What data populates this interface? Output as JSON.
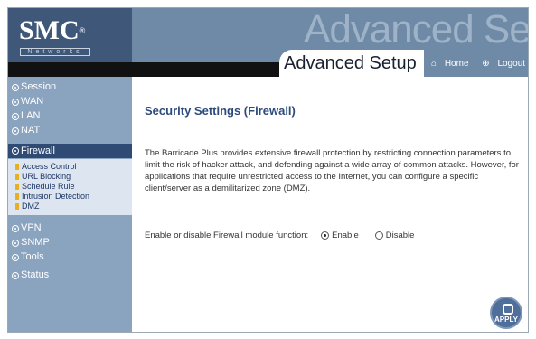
{
  "header": {
    "logo_text": "SMC",
    "logo_mark": "®",
    "logo_sub": "Networks",
    "watermark": "Advanced Setup",
    "title": "Advanced Setup",
    "nav_home": "Home",
    "nav_logout": "Logout",
    "icons": {
      "home": "home-icon",
      "logout": "logout-icon"
    }
  },
  "sidebar": {
    "items": [
      {
        "label": "Session"
      },
      {
        "label": "WAN"
      },
      {
        "label": "LAN"
      },
      {
        "label": "NAT"
      },
      {
        "label": "Firewall",
        "active": true
      },
      {
        "label": "VPN"
      },
      {
        "label": "SNMP"
      },
      {
        "label": "Tools"
      },
      {
        "label": "Status"
      }
    ],
    "submenu": [
      {
        "label": "Access Control"
      },
      {
        "label": "URL Blocking"
      },
      {
        "label": "Schedule Rule"
      },
      {
        "label": "Intrusion Detection"
      },
      {
        "label": "DMZ"
      }
    ]
  },
  "content": {
    "title": "Security Settings (Firewall)",
    "description": "The Barricade Plus provides extensive firewall protection by restricting connection parameters to limit the risk of hacker attack, and defending against a wide array of common attacks. However, for applications that require unrestricted access to the Internet, you can configure a specific client/server as a demilitarized zone (DMZ).",
    "form": {
      "label": "Enable or disable Firewall module function:",
      "options": [
        {
          "label": "Enable",
          "checked": true
        },
        {
          "label": "Disable",
          "checked": false
        }
      ]
    },
    "apply_label": "APPLY"
  },
  "colors": {
    "header_bg": "#6f8aa6",
    "logo_bg": "#3f587a",
    "sidebar_bg": "#8aa3bf",
    "active_bg": "#2f4a73",
    "title_color": "#2c4a7c"
  }
}
